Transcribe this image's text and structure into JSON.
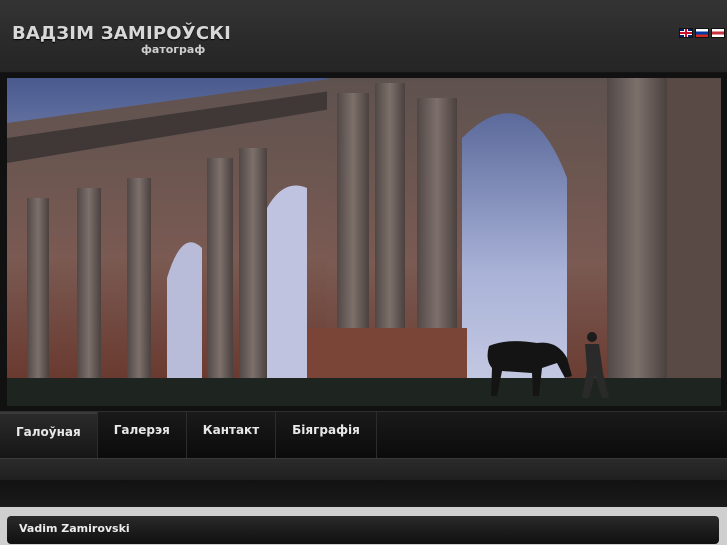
{
  "header": {
    "title": "ВАДЗІМ ЗАМІРОЎСКІ",
    "subtitle": "фатограф"
  },
  "languages": [
    {
      "icon": "flag-uk-icon",
      "code": "en"
    },
    {
      "icon": "flag-russia-icon",
      "code": "ru"
    },
    {
      "icon": "flag-belarus-icon",
      "code": "by"
    }
  ],
  "nav": {
    "items": [
      "Галоўная",
      "Галерэя",
      "Кантакт",
      "Біяграфія"
    ]
  },
  "footer": {
    "name": "Vadim Zamirovski"
  }
}
